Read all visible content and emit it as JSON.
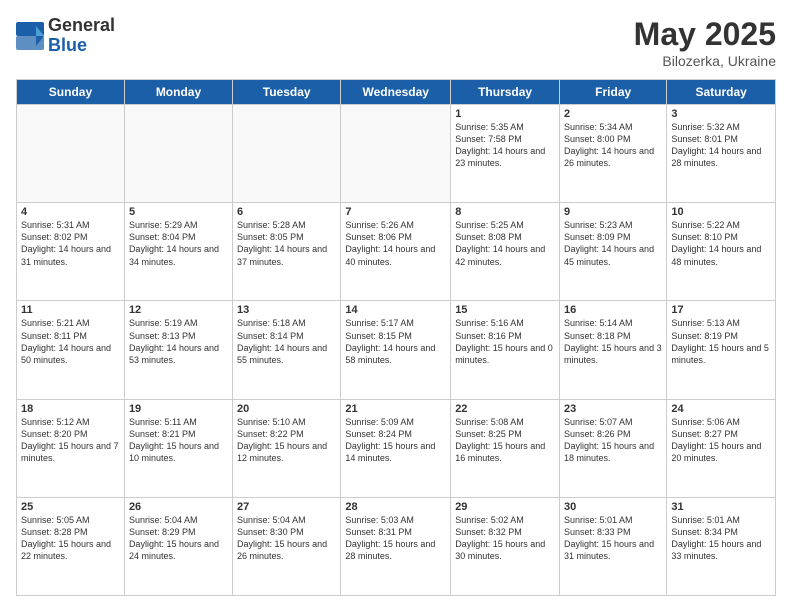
{
  "logo": {
    "general": "General",
    "blue": "Blue"
  },
  "header": {
    "month": "May 2025",
    "location": "Bilozerka, Ukraine"
  },
  "weekdays": [
    "Sunday",
    "Monday",
    "Tuesday",
    "Wednesday",
    "Thursday",
    "Friday",
    "Saturday"
  ],
  "weeks": [
    [
      {
        "day": "",
        "info": ""
      },
      {
        "day": "",
        "info": ""
      },
      {
        "day": "",
        "info": ""
      },
      {
        "day": "",
        "info": ""
      },
      {
        "day": "1",
        "info": "Sunrise: 5:35 AM\nSunset: 7:58 PM\nDaylight: 14 hours\nand 23 minutes."
      },
      {
        "day": "2",
        "info": "Sunrise: 5:34 AM\nSunset: 8:00 PM\nDaylight: 14 hours\nand 26 minutes."
      },
      {
        "day": "3",
        "info": "Sunrise: 5:32 AM\nSunset: 8:01 PM\nDaylight: 14 hours\nand 28 minutes."
      }
    ],
    [
      {
        "day": "4",
        "info": "Sunrise: 5:31 AM\nSunset: 8:02 PM\nDaylight: 14 hours\nand 31 minutes."
      },
      {
        "day": "5",
        "info": "Sunrise: 5:29 AM\nSunset: 8:04 PM\nDaylight: 14 hours\nand 34 minutes."
      },
      {
        "day": "6",
        "info": "Sunrise: 5:28 AM\nSunset: 8:05 PM\nDaylight: 14 hours\nand 37 minutes."
      },
      {
        "day": "7",
        "info": "Sunrise: 5:26 AM\nSunset: 8:06 PM\nDaylight: 14 hours\nand 40 minutes."
      },
      {
        "day": "8",
        "info": "Sunrise: 5:25 AM\nSunset: 8:08 PM\nDaylight: 14 hours\nand 42 minutes."
      },
      {
        "day": "9",
        "info": "Sunrise: 5:23 AM\nSunset: 8:09 PM\nDaylight: 14 hours\nand 45 minutes."
      },
      {
        "day": "10",
        "info": "Sunrise: 5:22 AM\nSunset: 8:10 PM\nDaylight: 14 hours\nand 48 minutes."
      }
    ],
    [
      {
        "day": "11",
        "info": "Sunrise: 5:21 AM\nSunset: 8:11 PM\nDaylight: 14 hours\nand 50 minutes."
      },
      {
        "day": "12",
        "info": "Sunrise: 5:19 AM\nSunset: 8:13 PM\nDaylight: 14 hours\nand 53 minutes."
      },
      {
        "day": "13",
        "info": "Sunrise: 5:18 AM\nSunset: 8:14 PM\nDaylight: 14 hours\nand 55 minutes."
      },
      {
        "day": "14",
        "info": "Sunrise: 5:17 AM\nSunset: 8:15 PM\nDaylight: 14 hours\nand 58 minutes."
      },
      {
        "day": "15",
        "info": "Sunrise: 5:16 AM\nSunset: 8:16 PM\nDaylight: 15 hours\nand 0 minutes."
      },
      {
        "day": "16",
        "info": "Sunrise: 5:14 AM\nSunset: 8:18 PM\nDaylight: 15 hours\nand 3 minutes."
      },
      {
        "day": "17",
        "info": "Sunrise: 5:13 AM\nSunset: 8:19 PM\nDaylight: 15 hours\nand 5 minutes."
      }
    ],
    [
      {
        "day": "18",
        "info": "Sunrise: 5:12 AM\nSunset: 8:20 PM\nDaylight: 15 hours\nand 7 minutes."
      },
      {
        "day": "19",
        "info": "Sunrise: 5:11 AM\nSunset: 8:21 PM\nDaylight: 15 hours\nand 10 minutes."
      },
      {
        "day": "20",
        "info": "Sunrise: 5:10 AM\nSunset: 8:22 PM\nDaylight: 15 hours\nand 12 minutes."
      },
      {
        "day": "21",
        "info": "Sunrise: 5:09 AM\nSunset: 8:24 PM\nDaylight: 15 hours\nand 14 minutes."
      },
      {
        "day": "22",
        "info": "Sunrise: 5:08 AM\nSunset: 8:25 PM\nDaylight: 15 hours\nand 16 minutes."
      },
      {
        "day": "23",
        "info": "Sunrise: 5:07 AM\nSunset: 8:26 PM\nDaylight: 15 hours\nand 18 minutes."
      },
      {
        "day": "24",
        "info": "Sunrise: 5:06 AM\nSunset: 8:27 PM\nDaylight: 15 hours\nand 20 minutes."
      }
    ],
    [
      {
        "day": "25",
        "info": "Sunrise: 5:05 AM\nSunset: 8:28 PM\nDaylight: 15 hours\nand 22 minutes."
      },
      {
        "day": "26",
        "info": "Sunrise: 5:04 AM\nSunset: 8:29 PM\nDaylight: 15 hours\nand 24 minutes."
      },
      {
        "day": "27",
        "info": "Sunrise: 5:04 AM\nSunset: 8:30 PM\nDaylight: 15 hours\nand 26 minutes."
      },
      {
        "day": "28",
        "info": "Sunrise: 5:03 AM\nSunset: 8:31 PM\nDaylight: 15 hours\nand 28 minutes."
      },
      {
        "day": "29",
        "info": "Sunrise: 5:02 AM\nSunset: 8:32 PM\nDaylight: 15 hours\nand 30 minutes."
      },
      {
        "day": "30",
        "info": "Sunrise: 5:01 AM\nSunset: 8:33 PM\nDaylight: 15 hours\nand 31 minutes."
      },
      {
        "day": "31",
        "info": "Sunrise: 5:01 AM\nSunset: 8:34 PM\nDaylight: 15 hours\nand 33 minutes."
      }
    ]
  ]
}
